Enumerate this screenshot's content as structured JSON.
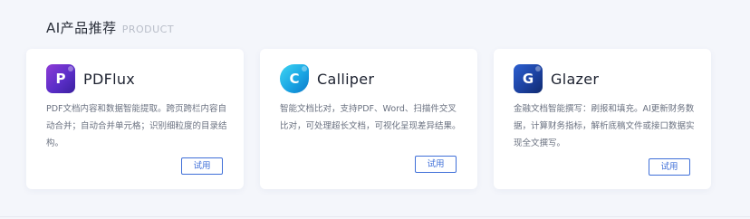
{
  "section": {
    "title": "AI产品推荐",
    "subtitle": "PRODUCT"
  },
  "products": [
    {
      "name": "PDFlux",
      "logo_letter": "P",
      "description": "PDF文档内容和数据智能提取。跨页跨栏内容自动合并；自动合并单元格；识别细粒度的目录结构。",
      "button_label": "试用",
      "logo_color": "#6a32cc"
    },
    {
      "name": "Calliper",
      "logo_letter": "C",
      "description": "智能文档比对，支持PDF、Word、扫描件交叉比对，可处理超长文档，可视化呈现差异结果。",
      "button_label": "试用",
      "logo_color": "#1aa6e4"
    },
    {
      "name": "Glazer",
      "logo_letter": "G",
      "description": "金融文档智能撰写：刷报和填充。AI更新财务数据，计算财务指标，解析底稿文件或接口数据实现全文撰写。",
      "button_label": "试用",
      "logo_color": "#1f4aa8"
    }
  ],
  "accent_color": "#3f6fd8"
}
